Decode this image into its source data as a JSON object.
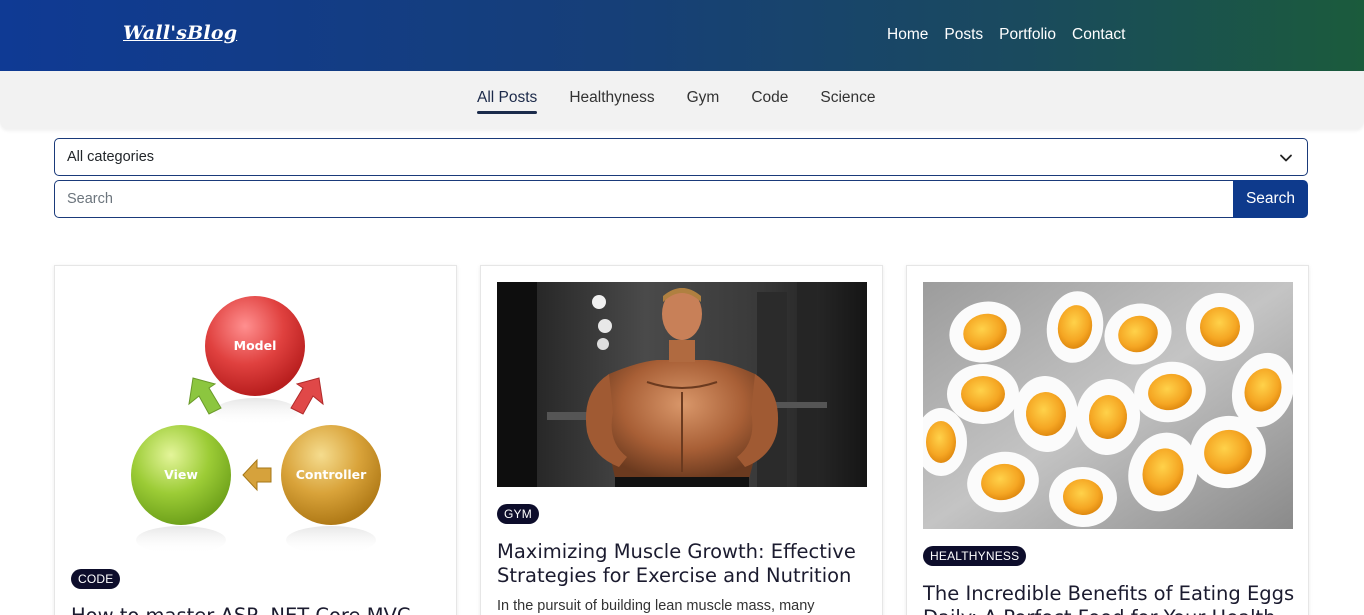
{
  "header": {
    "brand": "Wall'sBlog",
    "nav": [
      "Home",
      "Posts",
      "Portfolio",
      "Contact"
    ]
  },
  "subnav": {
    "tabs": [
      "All Posts",
      "Healthyness",
      "Gym",
      "Code",
      "Science"
    ],
    "active": "All Posts"
  },
  "filter": {
    "category_value": "All categories",
    "search_placeholder": "Search",
    "search_button": "Search"
  },
  "posts": [
    {
      "category": "CODE",
      "title": "How to master ASP .NET Core MVC",
      "image": "mvc-diagram",
      "diagram_labels": [
        "Model",
        "View",
        "Controller"
      ]
    },
    {
      "category": "GYM",
      "title": "Maximizing Muscle Growth: Effective Strategies for Exercise and Nutrition",
      "excerpt": "In the pursuit of building lean muscle mass, many",
      "image": "bodybuilder-photo"
    },
    {
      "category": "HEALTHYNESS",
      "title": "The Incredible Benefits of Eating Eggs Daily: A Perfect Food for Your Health",
      "image": "boiled-eggs-photo"
    }
  ]
}
